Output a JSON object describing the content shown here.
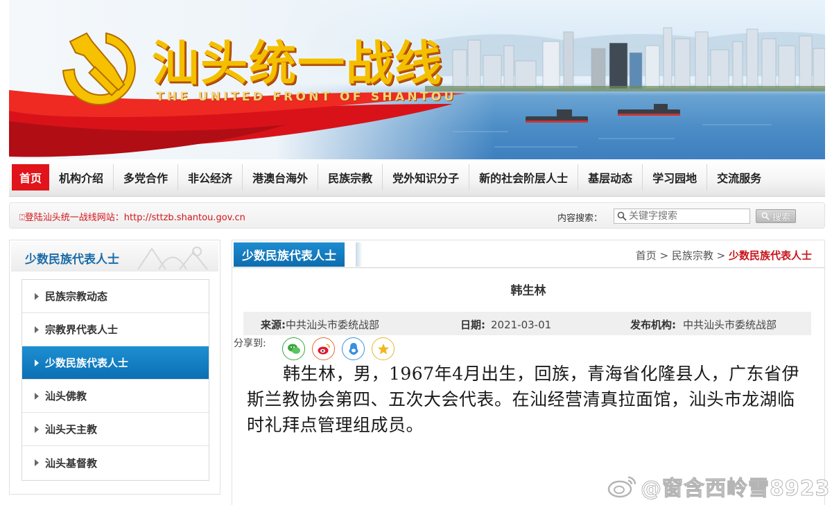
{
  "banner": {
    "title": "汕头统一战线",
    "subtitle": "THE UNITED FRONT OF SHANTOU"
  },
  "nav": {
    "items": [
      "首页",
      "机构介绍",
      "多党合作",
      "非公经济",
      "港澳台海外",
      "民族宗教",
      "党外知识分子",
      "新的社会阶层人士",
      "基层动态",
      "学习园地",
      "交流服务"
    ],
    "active_index": 0
  },
  "infobar": {
    "site_notice": "⍠登陆汕头统一战线网站：http://sttzb.shantou.gov.cn",
    "search_label": "内容搜索：",
    "search_placeholder": "关键字搜索",
    "search_button": "搜索"
  },
  "sidebar": {
    "title": "少数民族代表人士",
    "items": [
      {
        "label": "民族宗教动态"
      },
      {
        "label": "宗教界代表人士"
      },
      {
        "label": "少数民族代表人士"
      },
      {
        "label": "汕头佛教"
      },
      {
        "label": "汕头天主教"
      },
      {
        "label": "汕头基督教"
      }
    ],
    "active_index": 2
  },
  "main": {
    "tab_title": "少数民族代表人士",
    "breadcrumb": {
      "home": "首页",
      "sep1": " > ",
      "section": "民族宗教",
      "sep2": " > ",
      "current": "少数民族代表人士"
    },
    "article": {
      "title": "韩生林",
      "source_label": "来源:",
      "source_value": "中共汕头市委统战部",
      "date_label": "日期:",
      "date_value": "2021-03-01",
      "publisher_label": "发布机构:",
      "publisher_value": "中共汕头市委统战部",
      "share_label": "分享到:",
      "share_icons": [
        "wechat-icon",
        "weibo-icon",
        "qq-icon",
        "qzone-icon"
      ],
      "body": "韩生林，男，1967年4月出生，回族，青海省化隆县人，广东省伊斯兰教协会第四、五次大会代表。在汕经营清真拉面馆，汕头市龙湖临时礼拜点管理组成员。"
    }
  },
  "watermark": {
    "text": "@窗含西岭雪8923"
  },
  "colors": {
    "nav_active": "#e0141a",
    "accent_blue": "#1b6ca8",
    "breadcrumb_current": "#c8141a",
    "title_gold": "#f3c000"
  }
}
